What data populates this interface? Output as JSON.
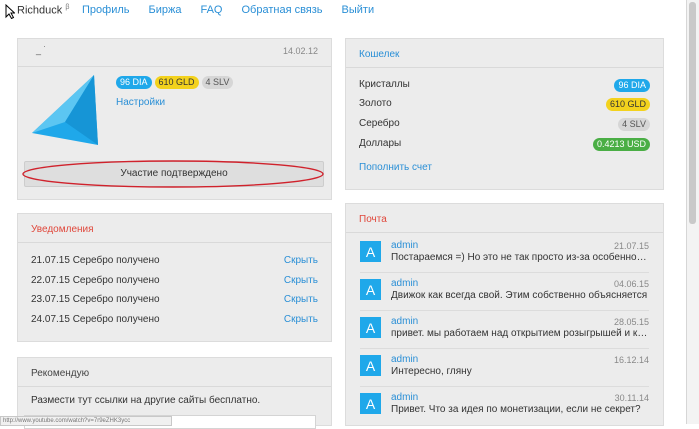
{
  "nav": {
    "brand": "Richduck",
    "brand_sup": "β",
    "items": [
      "Профиль",
      "Биржа",
      "FAQ",
      "Обратная связь",
      "Выйти"
    ]
  },
  "profile": {
    "username": "_ ˙",
    "date": "14.02.12",
    "badges": {
      "dia": "96 DIA",
      "gld": "610 GLD",
      "slv": "4 SLV"
    },
    "settings_label": "Настройки",
    "confirm_label": "Участие подтверждено"
  },
  "notifications": {
    "title": "Уведомления",
    "hide_label": "Скрыть",
    "items": [
      "21.07.15 Серебро получено",
      "22.07.15 Серебро получено",
      "23.07.15 Серебро получено",
      "24.07.15 Серебро получено"
    ]
  },
  "recommend": {
    "title": "Рекомендую",
    "text": "Размести тут ссылки на другие сайты бесплатно.",
    "status_url": "http://www.youtube.com/watch?v=7r9eZHK3ycc"
  },
  "wallet": {
    "title": "Кошелек",
    "rows": [
      {
        "label": "Кристаллы",
        "value": "96 DIA"
      },
      {
        "label": "Золото",
        "value": "610 GLD"
      },
      {
        "label": "Серебро",
        "value": "4 SLV"
      },
      {
        "label": "Доллары",
        "value": "0.4213 USD"
      }
    ],
    "topup_label": "Пополнить счет"
  },
  "mail": {
    "title": "Почта",
    "items": [
      {
        "avatar": "A",
        "from": "admin",
        "date": "21.07.15",
        "text": "Постараемся =) Но это не так просто из-за особенностей"
      },
      {
        "avatar": "A",
        "from": "admin",
        "date": "04.06.15",
        "text": "Движок как всегда свой. Этим собственно объясняется"
      },
      {
        "avatar": "A",
        "from": "admin",
        "date": "28.05.15",
        "text": "привет. мы работаем над открытием розыгрышей и конкурсов"
      },
      {
        "avatar": "A",
        "from": "admin",
        "date": "16.12.14",
        "text": "Интересно, гляну"
      },
      {
        "avatar": "A",
        "from": "admin",
        "date": "30.11.14",
        "text": "Привет. Что за идея по монетизации, если не секрет?"
      }
    ]
  },
  "colors": {
    "accent": "#2a8fd6",
    "alert": "#e0473b",
    "dia": "#1fa8ea",
    "gld": "#f3d21d",
    "slv": "#d6d6d6",
    "usd": "#4aae45",
    "highlight_ellipse": "#d0222c"
  },
  "icons": {
    "cursor": "cursor-arrow-icon",
    "logo": "triangle-logo-icon"
  }
}
